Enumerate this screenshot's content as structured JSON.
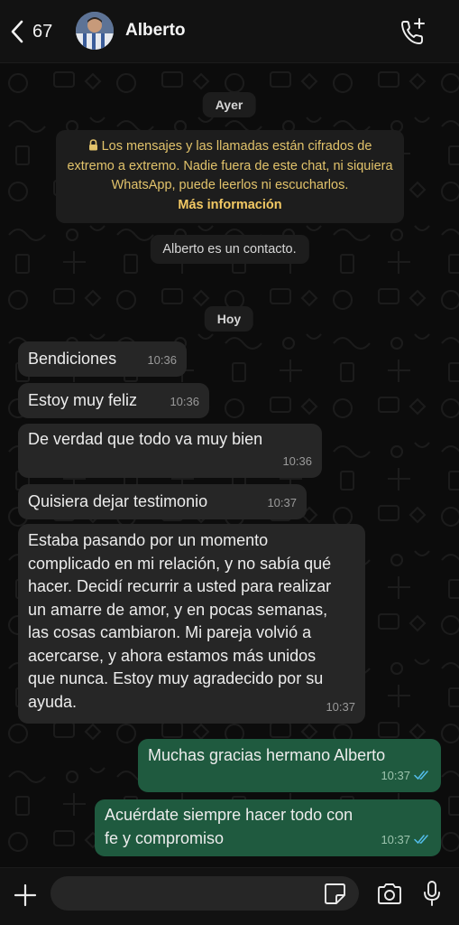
{
  "header": {
    "back_count": "67",
    "contact_name": "Alberto"
  },
  "chat": {
    "date_yesterday": "Ayer",
    "encryption_note": "Los mensajes y las llamadas están cifrados de extremo a extremo. Nadie fuera de este chat, ni siquiera WhatsApp, puede leerlos ni escucharlos.",
    "encryption_more": "Más información",
    "contact_note": "Alberto es un contacto.",
    "date_today": "Hoy",
    "messages": [
      {
        "direction": "in",
        "text": "Bendiciones",
        "time": "10:36"
      },
      {
        "direction": "in",
        "text": "Estoy muy feliz",
        "time": "10:36"
      },
      {
        "direction": "in",
        "text": "De verdad que todo va muy bien",
        "time": "10:36"
      },
      {
        "direction": "in",
        "text": "Quisiera dejar testimonio",
        "time": "10:37"
      },
      {
        "direction": "in",
        "text": "Estaba pasando por un momento complicado en mi relación, y no sabía qué hacer. Decidí recurrir a usted para realizar un amarre de amor, y en pocas semanas, las cosas cambiaron. Mi pareja volvió a acercarse, y ahora estamos más unidos que nunca. Estoy muy agradecido por su ayuda.",
        "time": "10:37"
      },
      {
        "direction": "out",
        "text": "Muchas gracias hermano Alberto",
        "time": "10:37",
        "status": "read"
      },
      {
        "direction": "out",
        "text": "Acuérdate siempre hacer todo con fe y compromiso",
        "time": "10:37",
        "status": "read"
      }
    ]
  },
  "composer": {
    "placeholder": ""
  },
  "icons": {
    "back": "chevron-left-icon",
    "call": "add-call-icon",
    "lock": "lock-icon",
    "ticks": "double-check-icon",
    "plus": "plus-icon",
    "sticker": "sticker-icon",
    "camera": "camera-icon",
    "mic": "microphone-icon"
  },
  "colors": {
    "incoming_bubble": "#262626",
    "outgoing_bubble": "#1f5a3f",
    "encryption_text": "#e2c36b",
    "read_ticks": "#53bdeb"
  }
}
